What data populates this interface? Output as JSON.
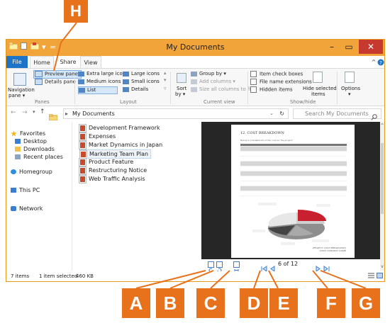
{
  "window": {
    "title": "My Documents"
  },
  "quick_access": {
    "items": [
      "▾",
      "="
    ]
  },
  "ribbon_tabs": [
    "File",
    "Home",
    "Share",
    "View"
  ],
  "ribbon": {
    "panes": {
      "navigation_pane": [
        "Navigation",
        "pane ▾"
      ],
      "preview_pane": "Preview pane",
      "details_pane": "Details pane",
      "group": "Panes"
    },
    "layout": {
      "extra_large": "Extra large icons",
      "large": "Large icons",
      "medium": "Medium icons",
      "small": "Small icons",
      "list": "List",
      "details": "Details",
      "group": "Layout"
    },
    "current_view": {
      "sort_by": [
        "Sort",
        "by ▾"
      ],
      "group_by": "Group by ▾",
      "add_columns": "Add columns ▾",
      "size_columns": "Size all columns to fit",
      "group": "Current view"
    },
    "show_hide": {
      "item_check_boxes": "Item check boxes",
      "file_name_ext": "File name extensions",
      "hidden_items": "Hidden items",
      "hide_selected": [
        "Hide selected",
        "items"
      ],
      "group": "Show/hide"
    },
    "options": {
      "label": "Options",
      "caret": "▾"
    }
  },
  "address": {
    "path": [
      "My Documents"
    ],
    "search_placeholder": "Search My Documents"
  },
  "nav": {
    "favorites": "Favorites",
    "favorites_items": [
      "Desktop",
      "Downloads",
      "Recent places"
    ],
    "homegroup": "Homegroup",
    "this_pc": "This PC",
    "network": "Network"
  },
  "files": [
    "Development Framework",
    "Expenses",
    "Market Dynamics in Japan",
    "Marketing Team Plan",
    "Product Feature",
    "Restructuring Notice",
    "Web Traffic Analysis"
  ],
  "selected_file": "Marketing Team Plan",
  "preview": {
    "heading": "12.  COST BREAKDOWN",
    "intro": "Below is a breakdown of the cost for the project:",
    "page_current": 6,
    "page_total": 12,
    "page_text": "6 of 12",
    "footer": [
      "PROJECT COST BREAKDOWN",
      "YOUR COMPANY NAME"
    ]
  },
  "status": {
    "items_count": "7 items",
    "selected": "1 item selected",
    "size": "460 KB"
  },
  "callouts": [
    "H",
    "A",
    "B",
    "C",
    "D",
    "E",
    "F",
    "G"
  ],
  "colors": {
    "accent": "#e8711c",
    "titlebar": "#f0a43a",
    "file_tab": "#1e74c7",
    "close": "#c7382f",
    "preview_bg": "#262626"
  }
}
